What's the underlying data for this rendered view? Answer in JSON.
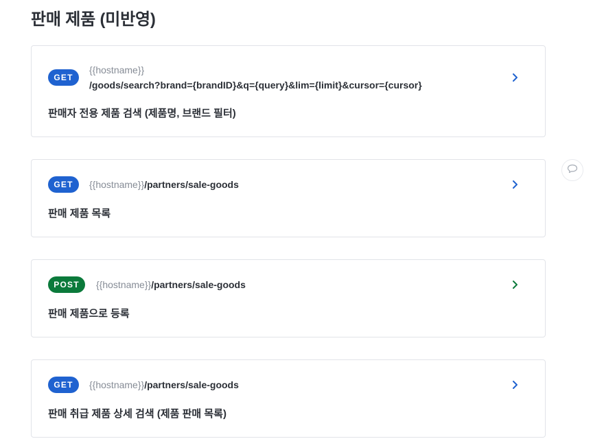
{
  "page": {
    "title": "판매 제품 (미반영)"
  },
  "endpoints": [
    {
      "method": "GET",
      "hostname": "{{hostname}}",
      "path": "/goods/search?brand={brandID}&q={query}&lim={limit}&cursor={cursor}",
      "description": "판매자 전용 제품 검색 (제품명, 브랜드 필터)"
    },
    {
      "method": "GET",
      "hostname": "{{hostname}}",
      "path": "/partners/sale-goods",
      "description": "판매 제품 목록"
    },
    {
      "method": "POST",
      "hostname": "{{hostname}}",
      "path": "/partners/sale-goods",
      "description": "판매 제품으로 등록"
    },
    {
      "method": "GET",
      "hostname": "{{hostname}}",
      "path": "/partners/sale-goods",
      "description": "판매 취급 제품 상세 검색 (제품 판매 목록)"
    }
  ],
  "colors": {
    "get_badge": "#1f62d0",
    "post_badge": "#0b7a3b",
    "get_chevron": "#1f62d0",
    "post_chevron": "#0b7a3b"
  },
  "icons": {
    "chevron": "chevron-right-icon",
    "comment": "comment-icon"
  }
}
